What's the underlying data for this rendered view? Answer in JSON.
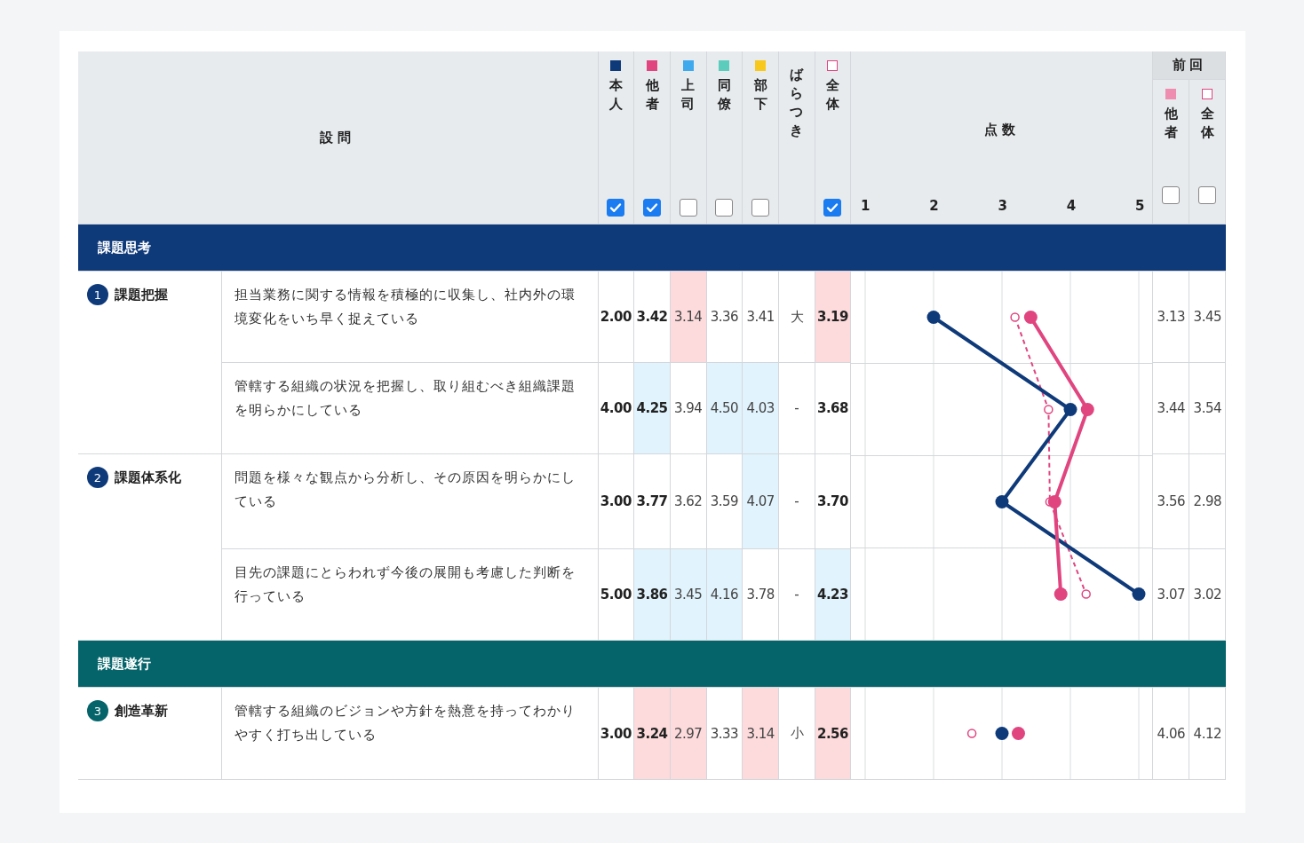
{
  "header": {
    "question_label": "設問",
    "score_label": "点数",
    "previous_label": "前回"
  },
  "columns": [
    {
      "label": "本人",
      "outline": false,
      "color": "#0f3a7a",
      "checked": true,
      "bold": true,
      "dashed": false
    },
    {
      "label": "他者",
      "outline": false,
      "color": "#e0457f",
      "checked": true,
      "bold": true,
      "dashed": false
    },
    {
      "label": "上司",
      "outline": false,
      "color": "#3fa9ee",
      "checked": false,
      "bold": false
    },
    {
      "label": "同僚",
      "outline": false,
      "color": "#5ccdbd",
      "checked": false,
      "bold": false
    },
    {
      "label": "部下",
      "outline": false,
      "color": "#f8c81c",
      "checked": false,
      "bold": false
    },
    {
      "label": "ばらつき",
      "bold": false
    },
    {
      "label": "全体",
      "outline": true,
      "color": "#e0457f",
      "checked": true,
      "bold": true,
      "dashed": true
    }
  ],
  "ticks": [
    "1",
    "2",
    "3",
    "4",
    "5"
  ],
  "previous_columns": [
    {
      "label": "他者",
      "outline": false,
      "color": "#ef8db0",
      "checked": false
    },
    {
      "label": "全体",
      "outline": true,
      "color": "#e0457f",
      "checked": false
    }
  ],
  "sections": [
    {
      "title": "課題思考",
      "color": "#0f3a7a",
      "categories": [
        {
          "number": "1",
          "name": "課題把握",
          "questions": [
            {
              "text": "担当業務に関する情報を積極的に収集し、社内外の環境変化をいち早く捉えている",
              "scores": [
                {
                  "value": "2.00",
                  "kind": "normal"
                },
                {
                  "value": "3.42",
                  "kind": "normal"
                },
                {
                  "value": "3.14",
                  "kind": "low"
                },
                {
                  "value": "3.36",
                  "kind": "normal"
                },
                {
                  "value": "3.41",
                  "kind": "normal"
                },
                {
                  "value": "大",
                  "kind": "normal"
                },
                {
                  "value": "3.19",
                  "kind": "low"
                }
              ],
              "previous": [
                "3.13",
                "3.45"
              ]
            },
            {
              "text": "管轄する組織の状況を把握し、取り組むべき組織課題を明らかにしている",
              "scores": [
                {
                  "value": "4.00",
                  "kind": "normal"
                },
                {
                  "value": "4.25",
                  "kind": "high"
                },
                {
                  "value": "3.94",
                  "kind": "normal"
                },
                {
                  "value": "4.50",
                  "kind": "high"
                },
                {
                  "value": "4.03",
                  "kind": "high"
                },
                {
                  "value": "-",
                  "kind": "normal"
                },
                {
                  "value": "3.68",
                  "kind": "normal"
                }
              ],
              "previous": [
                "3.44",
                "3.54"
              ]
            }
          ]
        },
        {
          "number": "2",
          "name": "課題体系化",
          "questions": [
            {
              "text": "問題を様々な観点から分析し、その原因を明らかにしている",
              "scores": [
                {
                  "value": "3.00",
                  "kind": "normal"
                },
                {
                  "value": "3.77",
                  "kind": "normal"
                },
                {
                  "value": "3.62",
                  "kind": "normal"
                },
                {
                  "value": "3.59",
                  "kind": "normal"
                },
                {
                  "value": "4.07",
                  "kind": "high"
                },
                {
                  "value": "-",
                  "kind": "normal"
                },
                {
                  "value": "3.70",
                  "kind": "normal"
                }
              ],
              "previous": [
                "3.56",
                "2.98"
              ]
            },
            {
              "text": "目先の課題にとらわれず今後の展開も考慮した判断を行っている",
              "scores": [
                {
                  "value": "5.00",
                  "kind": "normal"
                },
                {
                  "value": "3.86",
                  "kind": "high"
                },
                {
                  "value": "3.45",
                  "kind": "high"
                },
                {
                  "value": "4.16",
                  "kind": "high"
                },
                {
                  "value": "3.78",
                  "kind": "normal"
                },
                {
                  "value": "-",
                  "kind": "normal"
                },
                {
                  "value": "4.23",
                  "kind": "high"
                }
              ],
              "previous": [
                "3.07",
                "3.02"
              ]
            }
          ]
        }
      ]
    },
    {
      "title": "課題遂行",
      "color": "#05646a",
      "categories": [
        {
          "number": "3",
          "name": "創造革新",
          "questions": [
            {
              "text": "管轄する組織のビジョンや方針を熱意を持ってわかりやすく打ち出している",
              "scores": [
                {
                  "value": "3.00",
                  "kind": "normal"
                },
                {
                  "value": "3.24",
                  "kind": "low"
                },
                {
                  "value": "2.97",
                  "kind": "low"
                },
                {
                  "value": "3.33",
                  "kind": "normal"
                },
                {
                  "value": "3.14",
                  "kind": "low"
                },
                {
                  "value": "小",
                  "kind": "normal"
                },
                {
                  "value": "2.56",
                  "kind": "low"
                }
              ],
              "previous": [
                "4.06",
                "4.12"
              ]
            }
          ]
        }
      ]
    }
  ]
}
